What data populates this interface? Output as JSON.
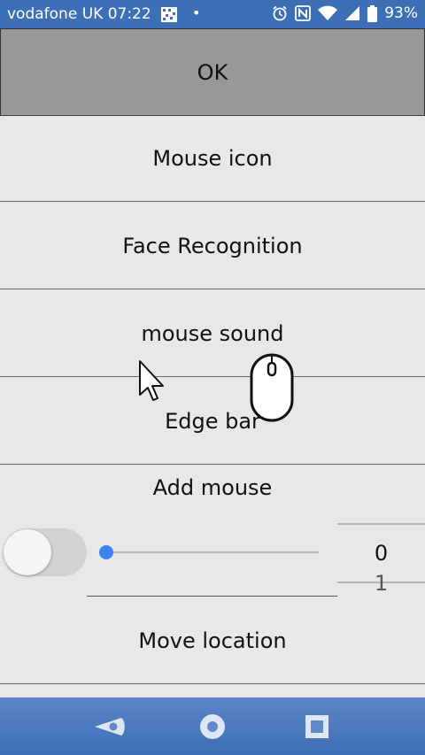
{
  "status_bar": {
    "carrier_time": "vodafone UK 07:22",
    "dot": "•",
    "battery": "93%",
    "icons": [
      "grid-icon",
      "alarm-icon",
      "nfc-icon",
      "wifi-icon",
      "signal-icon",
      "battery-icon"
    ]
  },
  "buttons": {
    "ok": "OK"
  },
  "menu": {
    "mouse_icon": "Mouse icon",
    "face_recognition": "Face Recognition",
    "mouse_sound": "mouse sound",
    "edge_bar": "Edge bar",
    "add_mouse": "Add mouse",
    "move_location": "Move location"
  },
  "add_mouse_controls": {
    "toggle_on": false,
    "slider_value": 0,
    "picker_value": "0",
    "picker_next": "1"
  },
  "nav_bar": {
    "icons": [
      "back-icon",
      "home-icon",
      "recent-apps-icon"
    ]
  },
  "colors": {
    "status_bar": "#3d6fb6",
    "ok_button": "#989898",
    "background": "#e8e8e8",
    "slider_accent": "#3e84f0"
  }
}
